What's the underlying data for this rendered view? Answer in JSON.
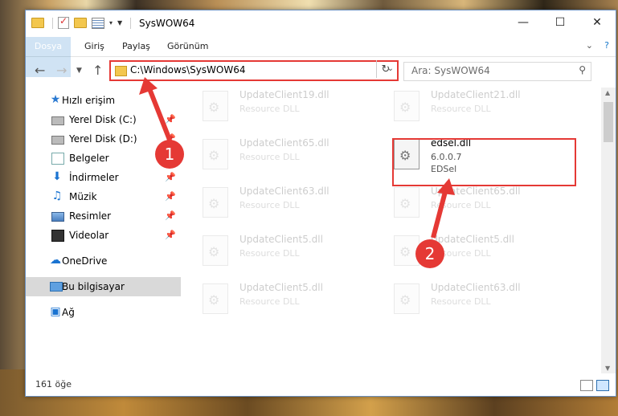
{
  "window": {
    "title": "SysWOW64"
  },
  "ribbon": {
    "tabs": [
      "Dosya",
      "Giriş",
      "Paylaş",
      "Görünüm"
    ]
  },
  "address": {
    "path": "C:\\Windows\\SysWOW64"
  },
  "search": {
    "placeholder": "Ara: SysWOW64"
  },
  "nav": {
    "items": [
      {
        "label": "Hızlı erişim",
        "icon": "star-icon"
      },
      {
        "label": "Yerel Disk (C:)",
        "icon": "disk-icon",
        "pinned": true
      },
      {
        "label": "Yerel Disk (D:)",
        "icon": "disk-icon",
        "pinned": true
      },
      {
        "label": "Belgeler",
        "icon": "document-icon",
        "pinned": true
      },
      {
        "label": "İndirmeler",
        "icon": "download-icon",
        "pinned": true
      },
      {
        "label": "Müzik",
        "icon": "music-icon",
        "pinned": true
      },
      {
        "label": "Resimler",
        "icon": "pictures-icon",
        "pinned": true
      },
      {
        "label": "Videolar",
        "icon": "video-icon",
        "pinned": true
      },
      {
        "label": "OneDrive",
        "icon": "cloud-icon"
      },
      {
        "label": "Bu bilgisayar",
        "icon": "computer-icon",
        "selected": true
      },
      {
        "label": "Ağ",
        "icon": "network-icon"
      }
    ]
  },
  "files": [
    {
      "name": "UpdateClient19.dll",
      "desc": "Resource DLL"
    },
    {
      "name": "UpdateClient21.dll",
      "desc": "Resource DLL"
    },
    {
      "name": "UpdateClient65.dll",
      "desc": "Resource DLL"
    },
    {
      "name": "edsel.dll",
      "version": "6.0.0.7",
      "company": "EDSel",
      "highlighted": true
    },
    {
      "name": "UpdateClient63.dll",
      "desc": "Resource DLL"
    },
    {
      "name": "UpdateClient65.dll",
      "desc": "Resource DLL"
    },
    {
      "name": "UpdateClient5.dll",
      "desc": "Resource DLL"
    },
    {
      "name": "UpdateClient5.dll",
      "desc": "Resource DLL"
    },
    {
      "name": "UpdateClient5.dll",
      "desc": "Resource DLL"
    },
    {
      "name": "UpdateClient63.dll",
      "desc": "Resource DLL"
    }
  ],
  "status": {
    "count": "161 öğe"
  },
  "annotations": {
    "badge1": "1",
    "badge2": "2"
  },
  "colors": {
    "accent": "#1979ca",
    "highlight": "#e53935"
  }
}
